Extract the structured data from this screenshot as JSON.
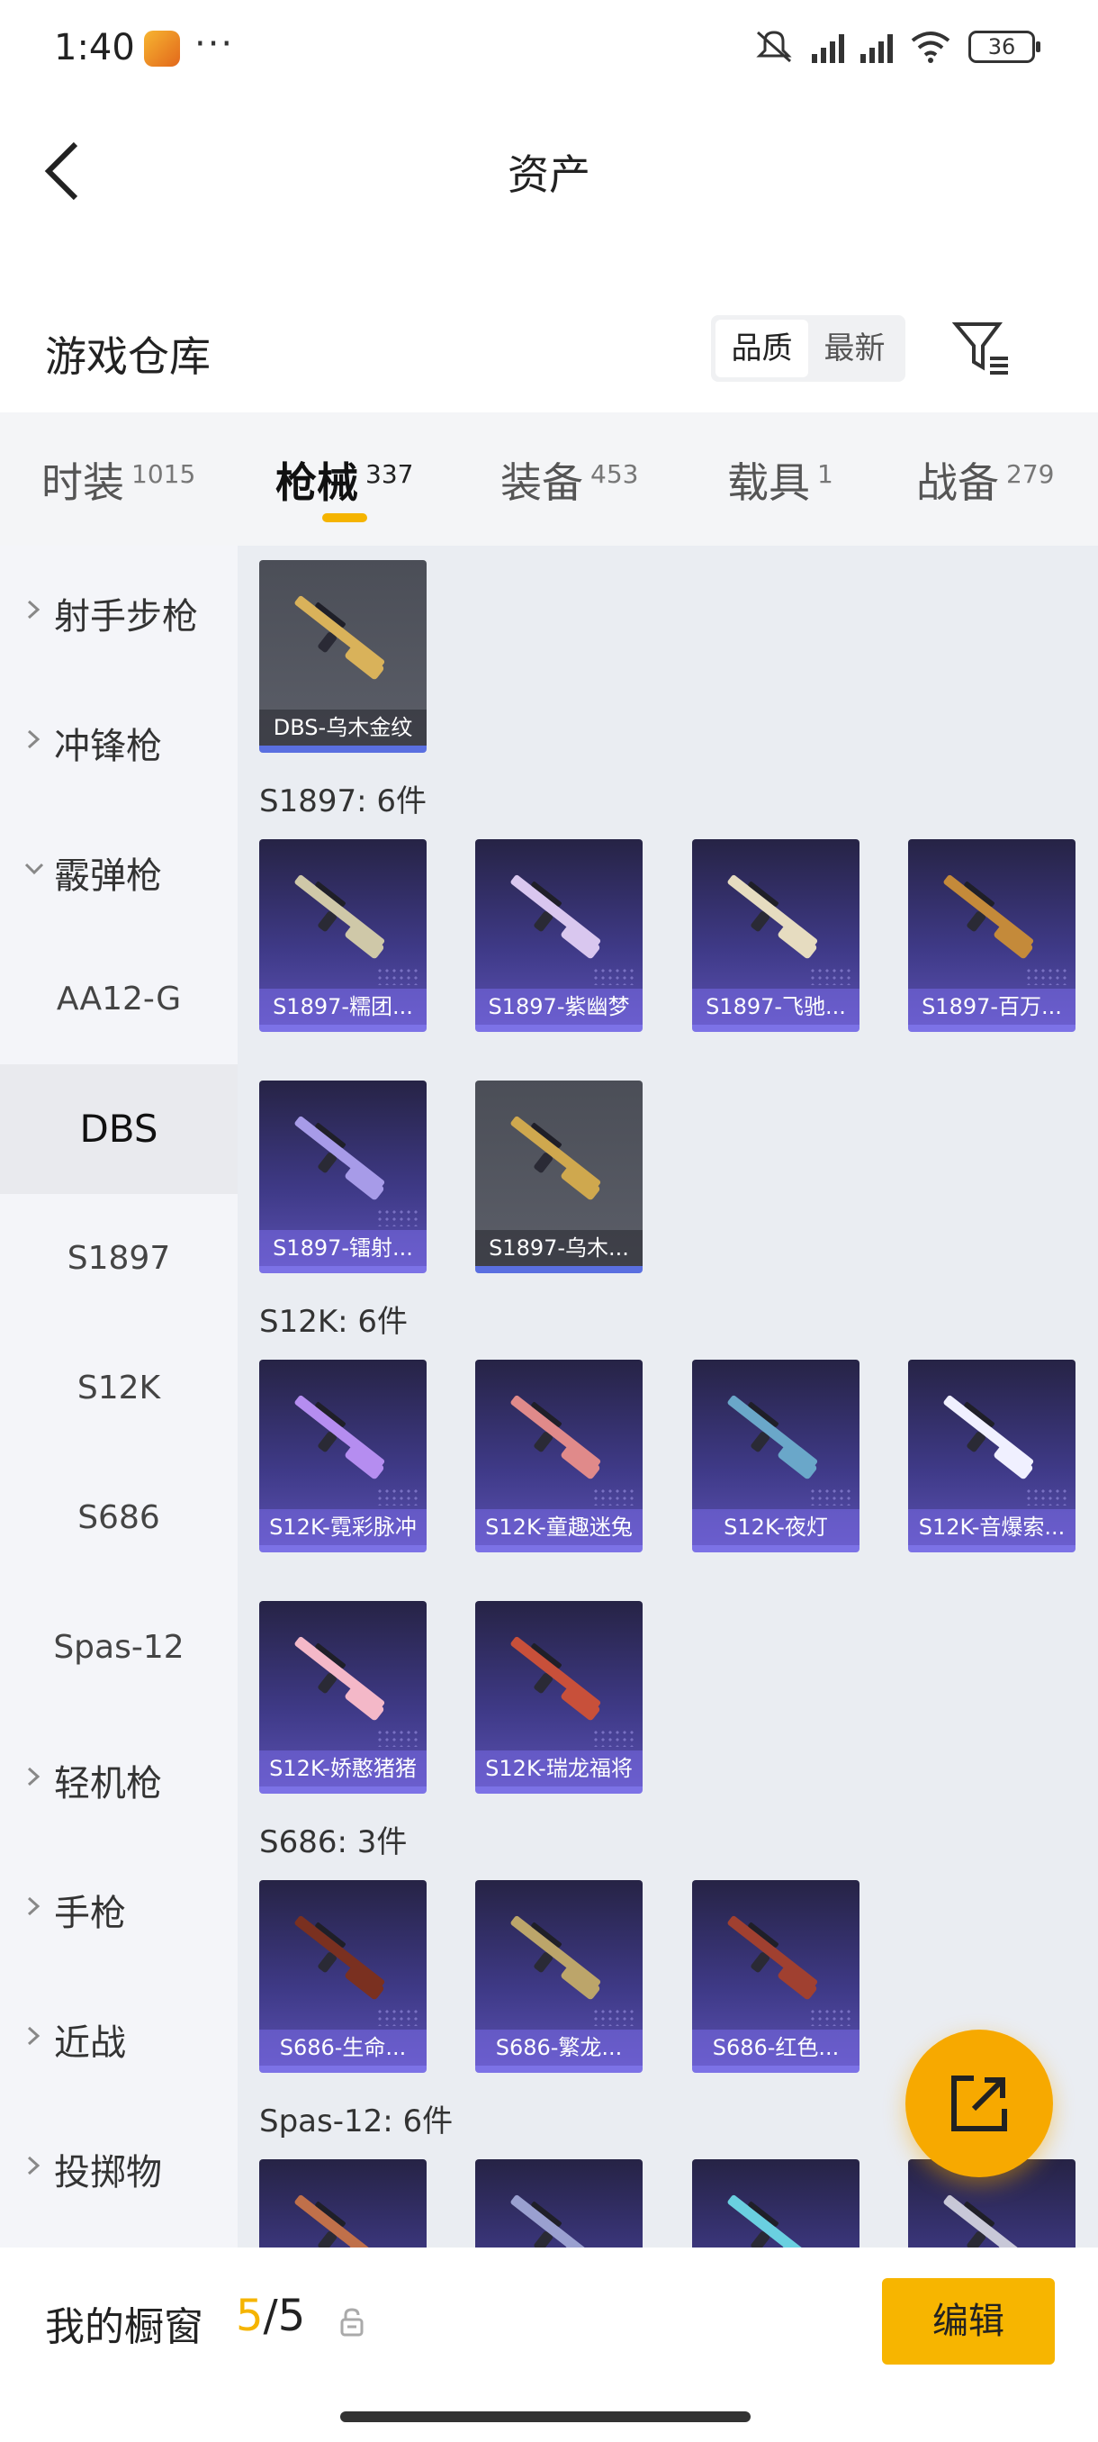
{
  "status_bar": {
    "time": "1:40",
    "more": "···",
    "battery": "36"
  },
  "header": {
    "title": "资产"
  },
  "warehouse": {
    "title": "游戏仓库",
    "sort_options": [
      "品质",
      "最新"
    ],
    "active_sort": "品质"
  },
  "tabs": [
    {
      "label": "时装",
      "count": "1015"
    },
    {
      "label": "枪械",
      "count": "337"
    },
    {
      "label": "装备",
      "count": "453"
    },
    {
      "label": "载具",
      "count": "1"
    },
    {
      "label": "战备",
      "count": "279"
    }
  ],
  "active_tab": "枪械",
  "sidebar": {
    "categories_top": [
      {
        "label": "射手步枪",
        "expanded": false
      },
      {
        "label": "冲锋枪",
        "expanded": false
      },
      {
        "label": "霰弹枪",
        "expanded": true
      }
    ],
    "subitems": [
      "AA12-G",
      "DBS",
      "S1897",
      "S12K",
      "S686",
      "Spas-12"
    ],
    "active_sub": "DBS",
    "categories_bottom": [
      {
        "label": "轻机枪",
        "expanded": false
      },
      {
        "label": "手枪",
        "expanded": false
      },
      {
        "label": "近战",
        "expanded": false
      },
      {
        "label": "投掷物",
        "expanded": false
      }
    ]
  },
  "sections": [
    {
      "header": "",
      "items": [
        {
          "name": "DBS-乌木金纹",
          "rarity": "grey",
          "color": "#d9b25a"
        }
      ]
    },
    {
      "header": "S1897: 6件",
      "items": [
        {
          "name": "S1897-糯团...",
          "rarity": "purple",
          "color": "#cfc8a8"
        },
        {
          "name": "S1897-紫幽梦",
          "rarity": "purple",
          "color": "#d9c7ef"
        },
        {
          "name": "S1897-飞驰...",
          "rarity": "purple",
          "color": "#e6dcc0"
        },
        {
          "name": "S1897-百万...",
          "rarity": "purple",
          "color": "#c48a3a"
        },
        {
          "name": "S1897-镭射...",
          "rarity": "purple",
          "color": "#a79be8"
        },
        {
          "name": "S1897-乌木...",
          "rarity": "grey",
          "color": "#cfa84e"
        }
      ]
    },
    {
      "header": "S12K: 6件",
      "items": [
        {
          "name": "S12K-霓彩脉冲",
          "rarity": "purple",
          "color": "#b58df0"
        },
        {
          "name": "S12K-童趣迷兔",
          "rarity": "purple",
          "color": "#e08a8a"
        },
        {
          "name": "S12K-夜灯",
          "rarity": "purple",
          "color": "#6aa7c9"
        },
        {
          "name": "S12K-音爆索...",
          "rarity": "purple",
          "color": "#f0f0ff"
        },
        {
          "name": "S12K-娇憨猪猪",
          "rarity": "purple",
          "color": "#f4b8c8"
        },
        {
          "name": "S12K-瑞龙福将",
          "rarity": "purple",
          "color": "#c8503a"
        }
      ]
    },
    {
      "header": "S686: 3件",
      "items": [
        {
          "name": "S686-生命...",
          "rarity": "purple",
          "color": "#7a3020"
        },
        {
          "name": "S686-繁龙...",
          "rarity": "purple",
          "color": "#bca56a"
        },
        {
          "name": "S686-红色...",
          "rarity": "purple",
          "color": "#a04030"
        }
      ]
    },
    {
      "header": "Spas-12: 6件",
      "items": [
        {
          "name": "",
          "rarity": "purple",
          "color": "#c0704a"
        },
        {
          "name": "",
          "rarity": "purple",
          "color": "#9aa0d0"
        },
        {
          "name": "",
          "rarity": "purple",
          "color": "#6ad0e0"
        },
        {
          "name": "",
          "rarity": "purple",
          "color": "#c8c8d8"
        }
      ]
    }
  ],
  "bottom_bar": {
    "label": "我的橱窗",
    "current": "5",
    "total": "/5",
    "edit_label": "编辑"
  },
  "colors": {
    "accent": "#f5b400",
    "purple_card": "#3f3a88",
    "grey_card": "#5b5e68"
  }
}
